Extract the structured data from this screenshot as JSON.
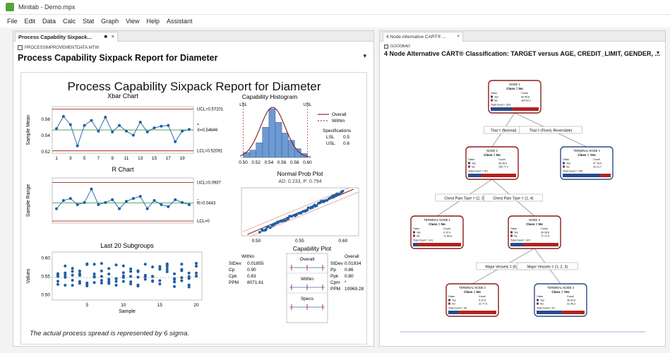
{
  "window": {
    "title": "Minitab - Demo.mpx"
  },
  "menu": [
    "File",
    "Edit",
    "Data",
    "Calc",
    "Stat",
    "Graph",
    "View",
    "Help",
    "Assistant"
  ],
  "left_pane": {
    "tab_label": "Process Capability Sixpack...",
    "pin": "■",
    "close": "×",
    "worksheet": "PROCESSIMPROVEMENTDATA.MTW",
    "report_title_prefix": "Process Capability Sixpack Report for ",
    "report_title_var": "Diameter",
    "dropdown": "▾"
  },
  "sixpack": {
    "title": "Process Capability Sixpack Report for Diameter",
    "xbar": {
      "title": "Xbar Chart",
      "ylabel": "Sample Mean",
      "y_ticks": [
        "0.56",
        "0.54",
        "0.52"
      ],
      "x_ticks": [
        "1",
        "3",
        "5",
        "7",
        "9",
        "11",
        "13",
        "15",
        "17",
        "19"
      ],
      "ucl": "UCL=0.57201",
      "center_sym": "=",
      "center": "X=0.54646",
      "lcl": "LCL=0.52091"
    },
    "rchart": {
      "title": "R Chart",
      "ylabel": "Sample Range",
      "ucl": "UCL=0.0937",
      "center_sym": "_",
      "center": "R=0.0443",
      "lcl": "LCL=0"
    },
    "last20": {
      "title": "Last 20 Subgroups",
      "ylabel": "Values",
      "xlabel": "Sample",
      "y_ticks": [
        "0.60",
        "0.55",
        "0.50"
      ],
      "x_ticks": [
        "5",
        "10",
        "15",
        "20"
      ]
    },
    "hist": {
      "title": "Capability Histogram",
      "lsl": "LSL",
      "usl": "USL",
      "x_ticks": [
        "0.50",
        "0.52",
        "0.54",
        "0.56",
        "0.58",
        "0.60"
      ],
      "legend_overall": "Overall",
      "legend_within": "Within",
      "spec_title": "Specifications",
      "spec_lsl_k": "LSL",
      "spec_lsl_v": "0.5",
      "spec_usl_k": "USL",
      "spec_usl_v": "0.6"
    },
    "normprob": {
      "title": "Normal Prob Plot",
      "subtitle": "AD: 0.233, P: 0.794",
      "x_ticks": [
        "0.50",
        "0.55",
        "0.60"
      ]
    },
    "capplot": {
      "title": "Capability Plot",
      "within_head": "Within",
      "overall_head": "Overall",
      "within_rows": [
        [
          "StDev",
          "0.01855"
        ],
        [
          "Cp",
          "0.90"
        ],
        [
          "Cpk",
          "0.83"
        ],
        [
          "PPM",
          "8071.61"
        ]
      ],
      "overall_rows": [
        [
          "StDev",
          "0.01934"
        ],
        [
          "Pp",
          "0.86"
        ],
        [
          "Ppk",
          "0.80"
        ],
        [
          "Cpm",
          "*"
        ],
        [
          "PPM",
          "10969.28"
        ]
      ],
      "box_overall": "Overall",
      "box_within": "Within",
      "box_specs": "Specs"
    },
    "footnote": "The actual process spread is represented by 6 sigma."
  },
  "right_pane": {
    "tab_label": "4 Node Alternative CART® ...",
    "close": "×",
    "worksheet": "GOODBAD",
    "title": "4 Node Alternative CART® Classification: TARGET versus AGE, CREDIT_LIMIT, GENDER, ...",
    "dropdown": "▾"
  },
  "tree": {
    "nodes": [
      {
        "head": "NODE 1",
        "cls": "Class = No",
        "yes": "26  45.8",
        "no": "164  54.1",
        "total": "Total Count = 303"
      },
      {
        "head": "NODE 2",
        "cls": "Class = No",
        "yes": "39  28.6",
        "no": "155  77.2",
        "total": "Total Count = 207"
      },
      {
        "head": "TERMINAL NODE 4",
        "cls": "Class = Yes",
        "yes": "97  78.5",
        "no": "23  21.7",
        "total": "Total Count = 106"
      },
      {
        "head": "TERMINAL NODE 1",
        "cls": "Class = No",
        "yes": "9  10.4",
        "no": "71  89.6",
        "total": "Total Count = 101"
      },
      {
        "head": "NODE 3",
        "cls": "Class = No",
        "yes": "30  28.6",
        "no": "77  71.4",
        "total": "Total Count = 107"
      },
      {
        "head": "TERMINAL NODE 2",
        "cls": "Class = No",
        "yes": "9  22.5",
        "no": "31  77.5",
        "total": "Total Count = 40"
      },
      {
        "head": "TERMINAL NODE 3",
        "cls": "Class = Yes",
        "yes": "36  53.5",
        "no": "31  46.3",
        "total": "Total Count = 67"
      }
    ],
    "row_yes": "Yes",
    "row_no": "No",
    "col_class": "Class",
    "col_count": "Count",
    "splits": [
      "Thal = (Normal)",
      "Thal = (Fixed, Reversible)",
      "Chest Pain Type = (2, 3)",
      "Chest Pain Type = (1, 4)",
      "Major Vessels = (0, 4)",
      "Major Vessels = (1, 2, 3)"
    ]
  }
}
